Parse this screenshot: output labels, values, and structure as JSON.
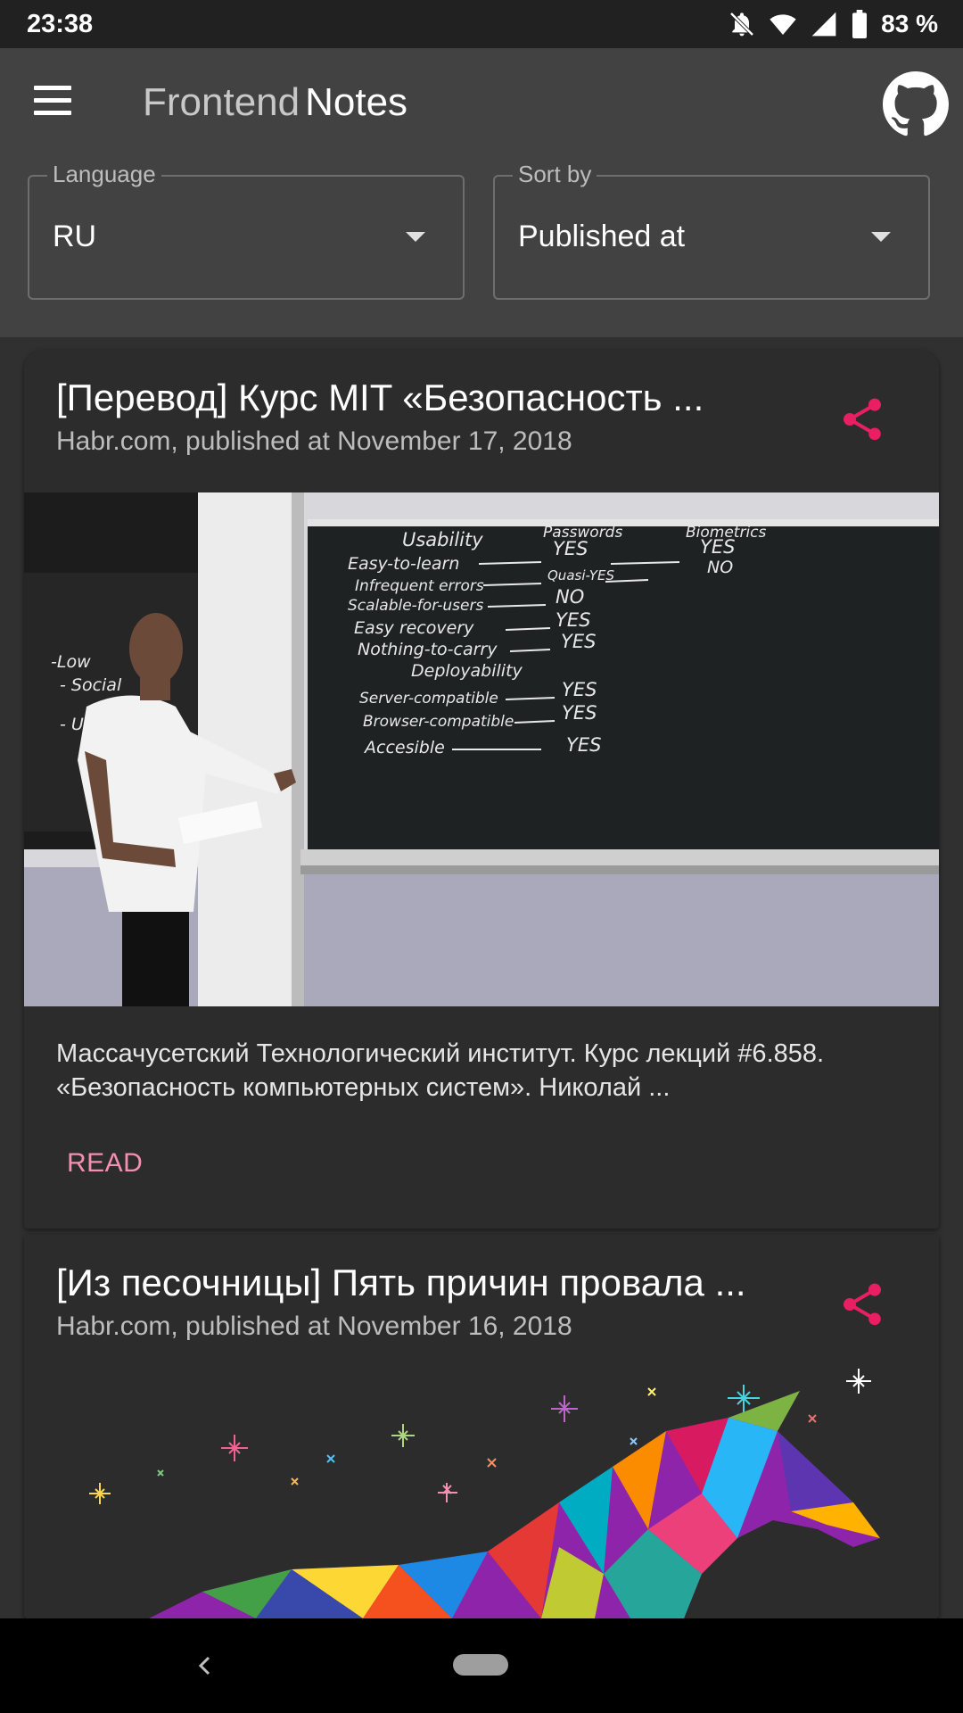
{
  "status_bar": {
    "time": "23:38",
    "battery": "83 %",
    "icons": [
      "notifications-off-icon",
      "wifi-icon",
      "signal-icon",
      "battery-icon"
    ]
  },
  "app_bar": {
    "title_part1": "Frontend",
    "title_part2": "Notes",
    "menu_icon": "hamburger-menu-icon",
    "github_icon": "github-icon"
  },
  "filters": {
    "language": {
      "label": "Language",
      "value": "RU"
    },
    "sort": {
      "label": "Sort by",
      "value": "Published at"
    }
  },
  "articles": [
    {
      "title": "[Перевод] Курс MIT «Безопасность ...",
      "source": "Habr.com, published at November 17, 2018",
      "excerpt": "Массачусетский Технологический институт. Курс лекций #6.858. «Безопасность компьютерных систем». Николай ...",
      "action": "READ",
      "image": {
        "board_heading": "Usability",
        "board_cols": [
          "Passwords",
          "Biometrics"
        ],
        "board_rows": [
          "Easy-to-learn",
          "Infrequent errors",
          "Scalable-for-users",
          "Easy recovery",
          "Nothing-to-carry",
          "Deployability",
          "Server-compatible",
          "Browser-compatible",
          "Accesible"
        ],
        "board_values": [
          "YES",
          "Quasi-YES",
          "NO",
          "YES",
          "YES",
          "YES",
          "YES",
          "YES"
        ],
        "board_values2": [
          "YES",
          "NO"
        ],
        "left_board": [
          "-Low",
          "- Social",
          "- U"
        ]
      }
    },
    {
      "title": "[Из песочницы] Пять причин провала ...",
      "source": "Habr.com, published at November 16, 2018"
    }
  ],
  "colors": {
    "background": "#303030",
    "app_bar": "#424242",
    "card": "#2c2c2c",
    "accent_share": "#e91e63",
    "accent_read": "#f48fb1"
  },
  "nav_bar": {
    "back_icon": "back-chevron-icon",
    "home_icon": "home-pill-icon"
  }
}
